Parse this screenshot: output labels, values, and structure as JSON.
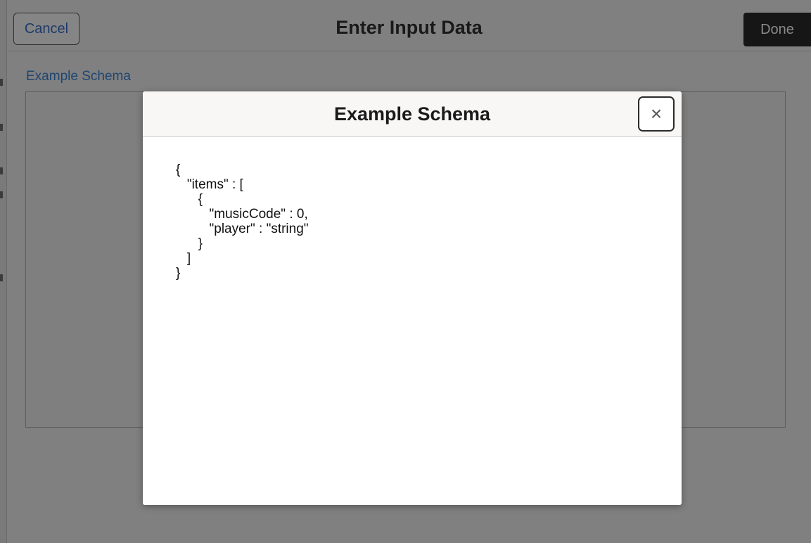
{
  "header": {
    "cancel_label": "Cancel",
    "title": "Enter Input Data",
    "done_label": "Done"
  },
  "form": {
    "field_label": "Example Schema",
    "textarea_value": ""
  },
  "modal": {
    "title": "Example Schema",
    "close_icon": "×",
    "schema_lines": [
      "{",
      "   \"items\" : [",
      "      {",
      "         \"musicCode\" : 0,",
      "         \"player\" : \"string\"",
      "      }",
      "   ]",
      "}"
    ]
  },
  "colors": {
    "overlay_background": "#808080",
    "modal_background": "#ffffff",
    "modal_header_background": "#f8f7f6",
    "done_button": "#161616",
    "link_text": "#1f4570"
  }
}
